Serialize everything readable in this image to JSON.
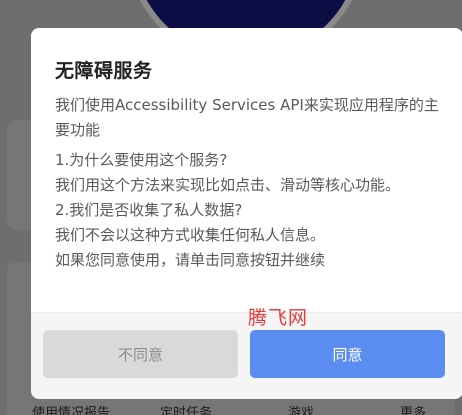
{
  "background": {
    "bottom_labels": [
      "使用情况报告",
      "定时任务",
      "游戏",
      "更多"
    ]
  },
  "dialog": {
    "title": "无障碍服务",
    "intro": "我们使用Accessibility Services API来实现应用程序的主要功能",
    "q1": "1.为什么要使用这个服务?",
    "a1": "我们用这个方法来实现比如点击、滑动等核心功能。",
    "q2": "2.我们是否收集了私人数据?",
    "a2": "我们不会以这种方式收集任何私人信息。",
    "instruction": "如果您同意使用，请单击同意按钮并继续",
    "decline_label": "不同意",
    "accept_label": "同意"
  },
  "watermark": "腾飞网",
  "colors": {
    "accent": "#5b8df0",
    "decline_bg": "#d9d9d9",
    "watermark": "#e43b3b"
  }
}
